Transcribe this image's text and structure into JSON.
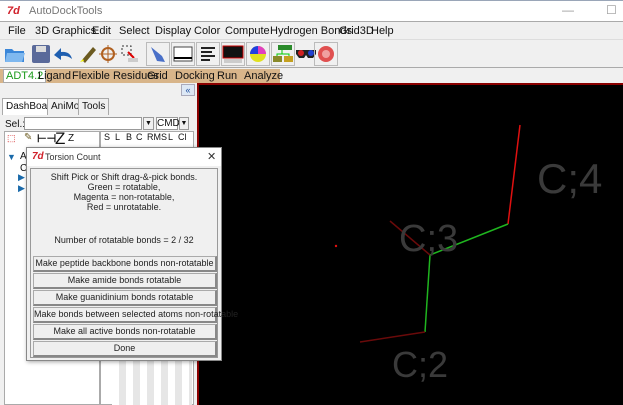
{
  "window": {
    "title": "AutoDockTools",
    "logo": "7d",
    "minimize": "—",
    "maximize": "☐"
  },
  "menu": [
    "File",
    "3D Graphics",
    "Edit",
    "Select",
    "Display",
    "Color",
    "Compute",
    "Hydrogen Bonds",
    "Grid3D",
    "Help"
  ],
  "toolbar_icons": [
    "open-folder-icon",
    "save-icon",
    "undo-icon",
    "pencil-icon",
    "crosshair-icon",
    "select-icon",
    "pick-hand-icon",
    "window-icon",
    "text-lines-icon",
    "monitor-icon",
    "color-ball-icon",
    "tree-icon",
    "3d-glasses-icon",
    "render-icon"
  ],
  "adt_tabs": [
    "ADT4.2",
    "Ligand",
    "Flexible Residues",
    "Grid",
    "Docking",
    "Run",
    "Analyze"
  ],
  "panel_tabs": [
    "DashBoard",
    "AniMol",
    "Tools"
  ],
  "sel_label": "Sel.:",
  "sel_value": "",
  "cmd_label": "CMD",
  "dash_cols": [
    "S",
    "L",
    "B",
    "C",
    "RMS",
    "L",
    "Cl"
  ],
  "dash_tools": {
    "z_big": "Z",
    "z_small": "Z"
  },
  "tree": {
    "root": "A",
    "child": "C"
  },
  "dialog": {
    "title": "Torsion Count",
    "instructions": [
      "Shift Pick or Shift drag-&-pick bonds.",
      "Green = rotatable,",
      "Magenta = non-rotatable,",
      "Red = unrotatable."
    ],
    "count_text": "Number of rotatable bonds = 2 / 32",
    "buttons": [
      "Make peptide backbone bonds non-rotatable",
      "Make amide bonds rotatable",
      "Make guanidinium bonds rotatable",
      "Make bonds between selected atoms non-rotatable",
      "Make all active bonds non-rotatable",
      "Done"
    ],
    "close": "✕"
  },
  "viewer": {
    "atom_labels": [
      "C;4",
      "C;3",
      "C;2"
    ],
    "colors": {
      "rotatable": "#1fb51f",
      "unrotatable": "#e01010",
      "dim_red": "#6a0a0a",
      "background": "#000000"
    }
  }
}
